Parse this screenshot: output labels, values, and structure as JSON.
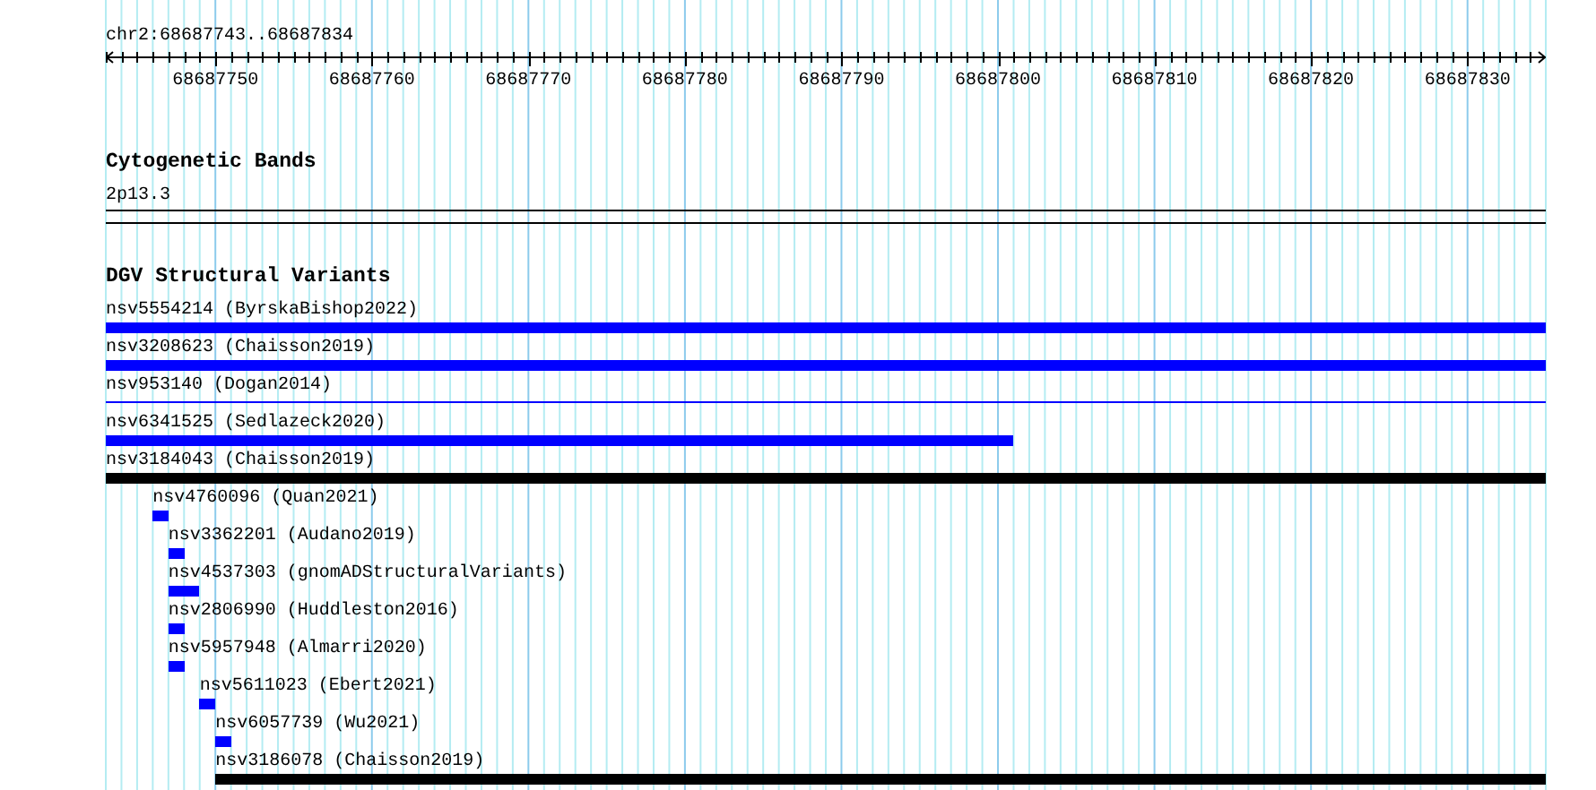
{
  "location": "chr2:68687743..68687834",
  "ruler": {
    "ticks": [
      "68687750",
      "68687760",
      "68687770",
      "68687780",
      "68687790",
      "68687800",
      "68687810",
      "68687820",
      "68687830"
    ]
  },
  "tracks": [
    {
      "title": "Cytogenetic Bands",
      "kind": "bands",
      "features": [
        {
          "label": "2p13.3"
        }
      ]
    },
    {
      "title": "DGV Structural Variants",
      "kind": "variants",
      "features": [
        {
          "label": "nsv5554214 (ByrskaBishop2022)",
          "kind": "bar",
          "color": "#0000ff"
        },
        {
          "label": "nsv3208623 (Chaisson2019)",
          "kind": "bar",
          "color": "#0000ff"
        },
        {
          "label": "nsv953140 (Dogan2014)",
          "kind": "line",
          "color": "#0000ff"
        },
        {
          "label": "nsv6341525 (Sedlazeck2020)",
          "kind": "bar",
          "color": "#0000ff"
        },
        {
          "label": "nsv3184043 (Chaisson2019)",
          "kind": "bar",
          "color": "#000000"
        },
        {
          "label": "nsv4760096 (Quan2021)",
          "kind": "bar",
          "color": "#0000ff"
        },
        {
          "label": "nsv3362201 (Audano2019)",
          "kind": "bar",
          "color": "#0000ff"
        },
        {
          "label": "nsv4537303 (gnomADStructuralVariants)",
          "kind": "bar",
          "color": "#0000ff"
        },
        {
          "label": "nsv2806990 (Huddleston2016)",
          "kind": "bar",
          "color": "#0000ff"
        },
        {
          "label": "nsv5957948 (Almarri2020)",
          "kind": "bar",
          "color": "#0000ff"
        },
        {
          "label": "nsv5611023 (Ebert2021)",
          "kind": "bar",
          "color": "#0000ff"
        },
        {
          "label": "nsv6057739 (Wu2021)",
          "kind": "bar",
          "color": "#0000ff"
        },
        {
          "label": "nsv3186078 (Chaisson2019)",
          "kind": "bar",
          "color": "#000000"
        }
      ]
    }
  ]
}
